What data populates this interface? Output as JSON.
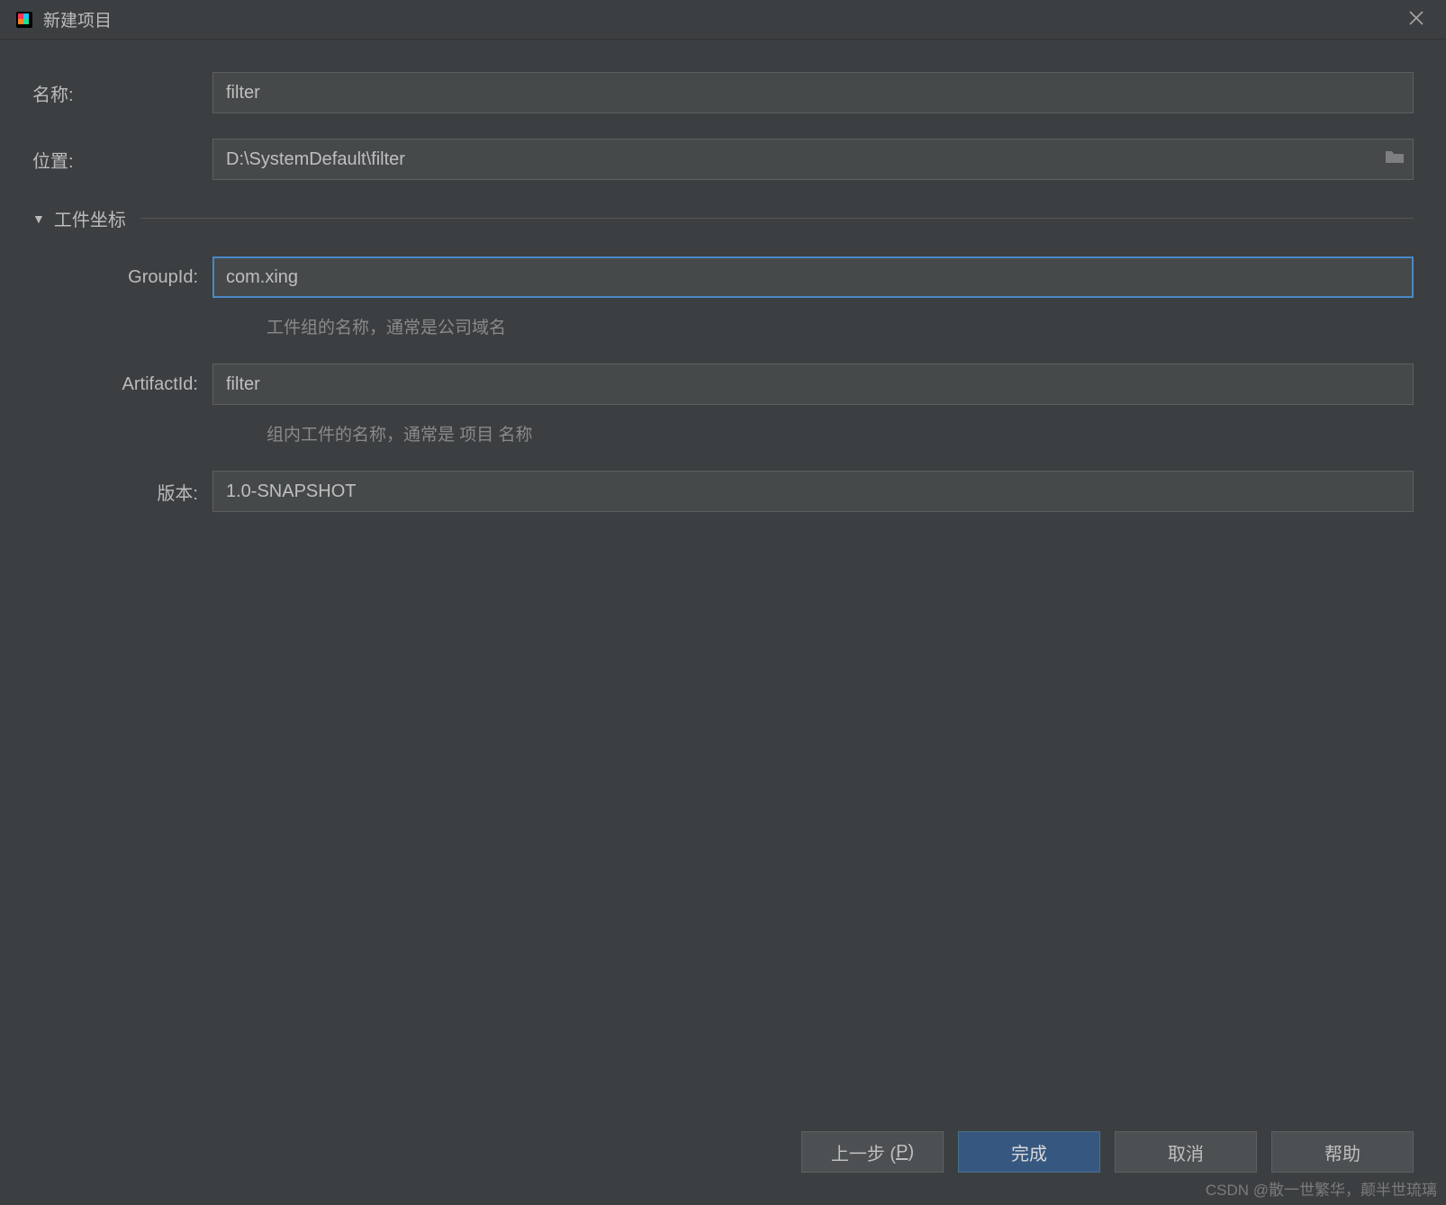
{
  "window": {
    "title": "新建项目"
  },
  "form": {
    "name": {
      "label": "名称:",
      "value": "filter"
    },
    "location": {
      "label": "位置:",
      "value": "D:\\SystemDefault\\filter"
    },
    "section": {
      "title": "工件坐标"
    },
    "groupId": {
      "label": "GroupId:",
      "value": "com.xing",
      "hint": "工件组的名称，通常是公司域名"
    },
    "artifactId": {
      "label": "ArtifactId:",
      "value": "filter",
      "hint": "组内工件的名称，通常是 项目 名称"
    },
    "version": {
      "label": "版本:",
      "value": "1.0-SNAPSHOT"
    }
  },
  "buttons": {
    "prev_prefix": "上一步 (",
    "prev_mnemonic": "P",
    "prev_suffix": ")",
    "finish": "完成",
    "cancel": "取消",
    "help": "帮助"
  },
  "watermark": "CSDN @散一世繁华，颠半世琉璃"
}
